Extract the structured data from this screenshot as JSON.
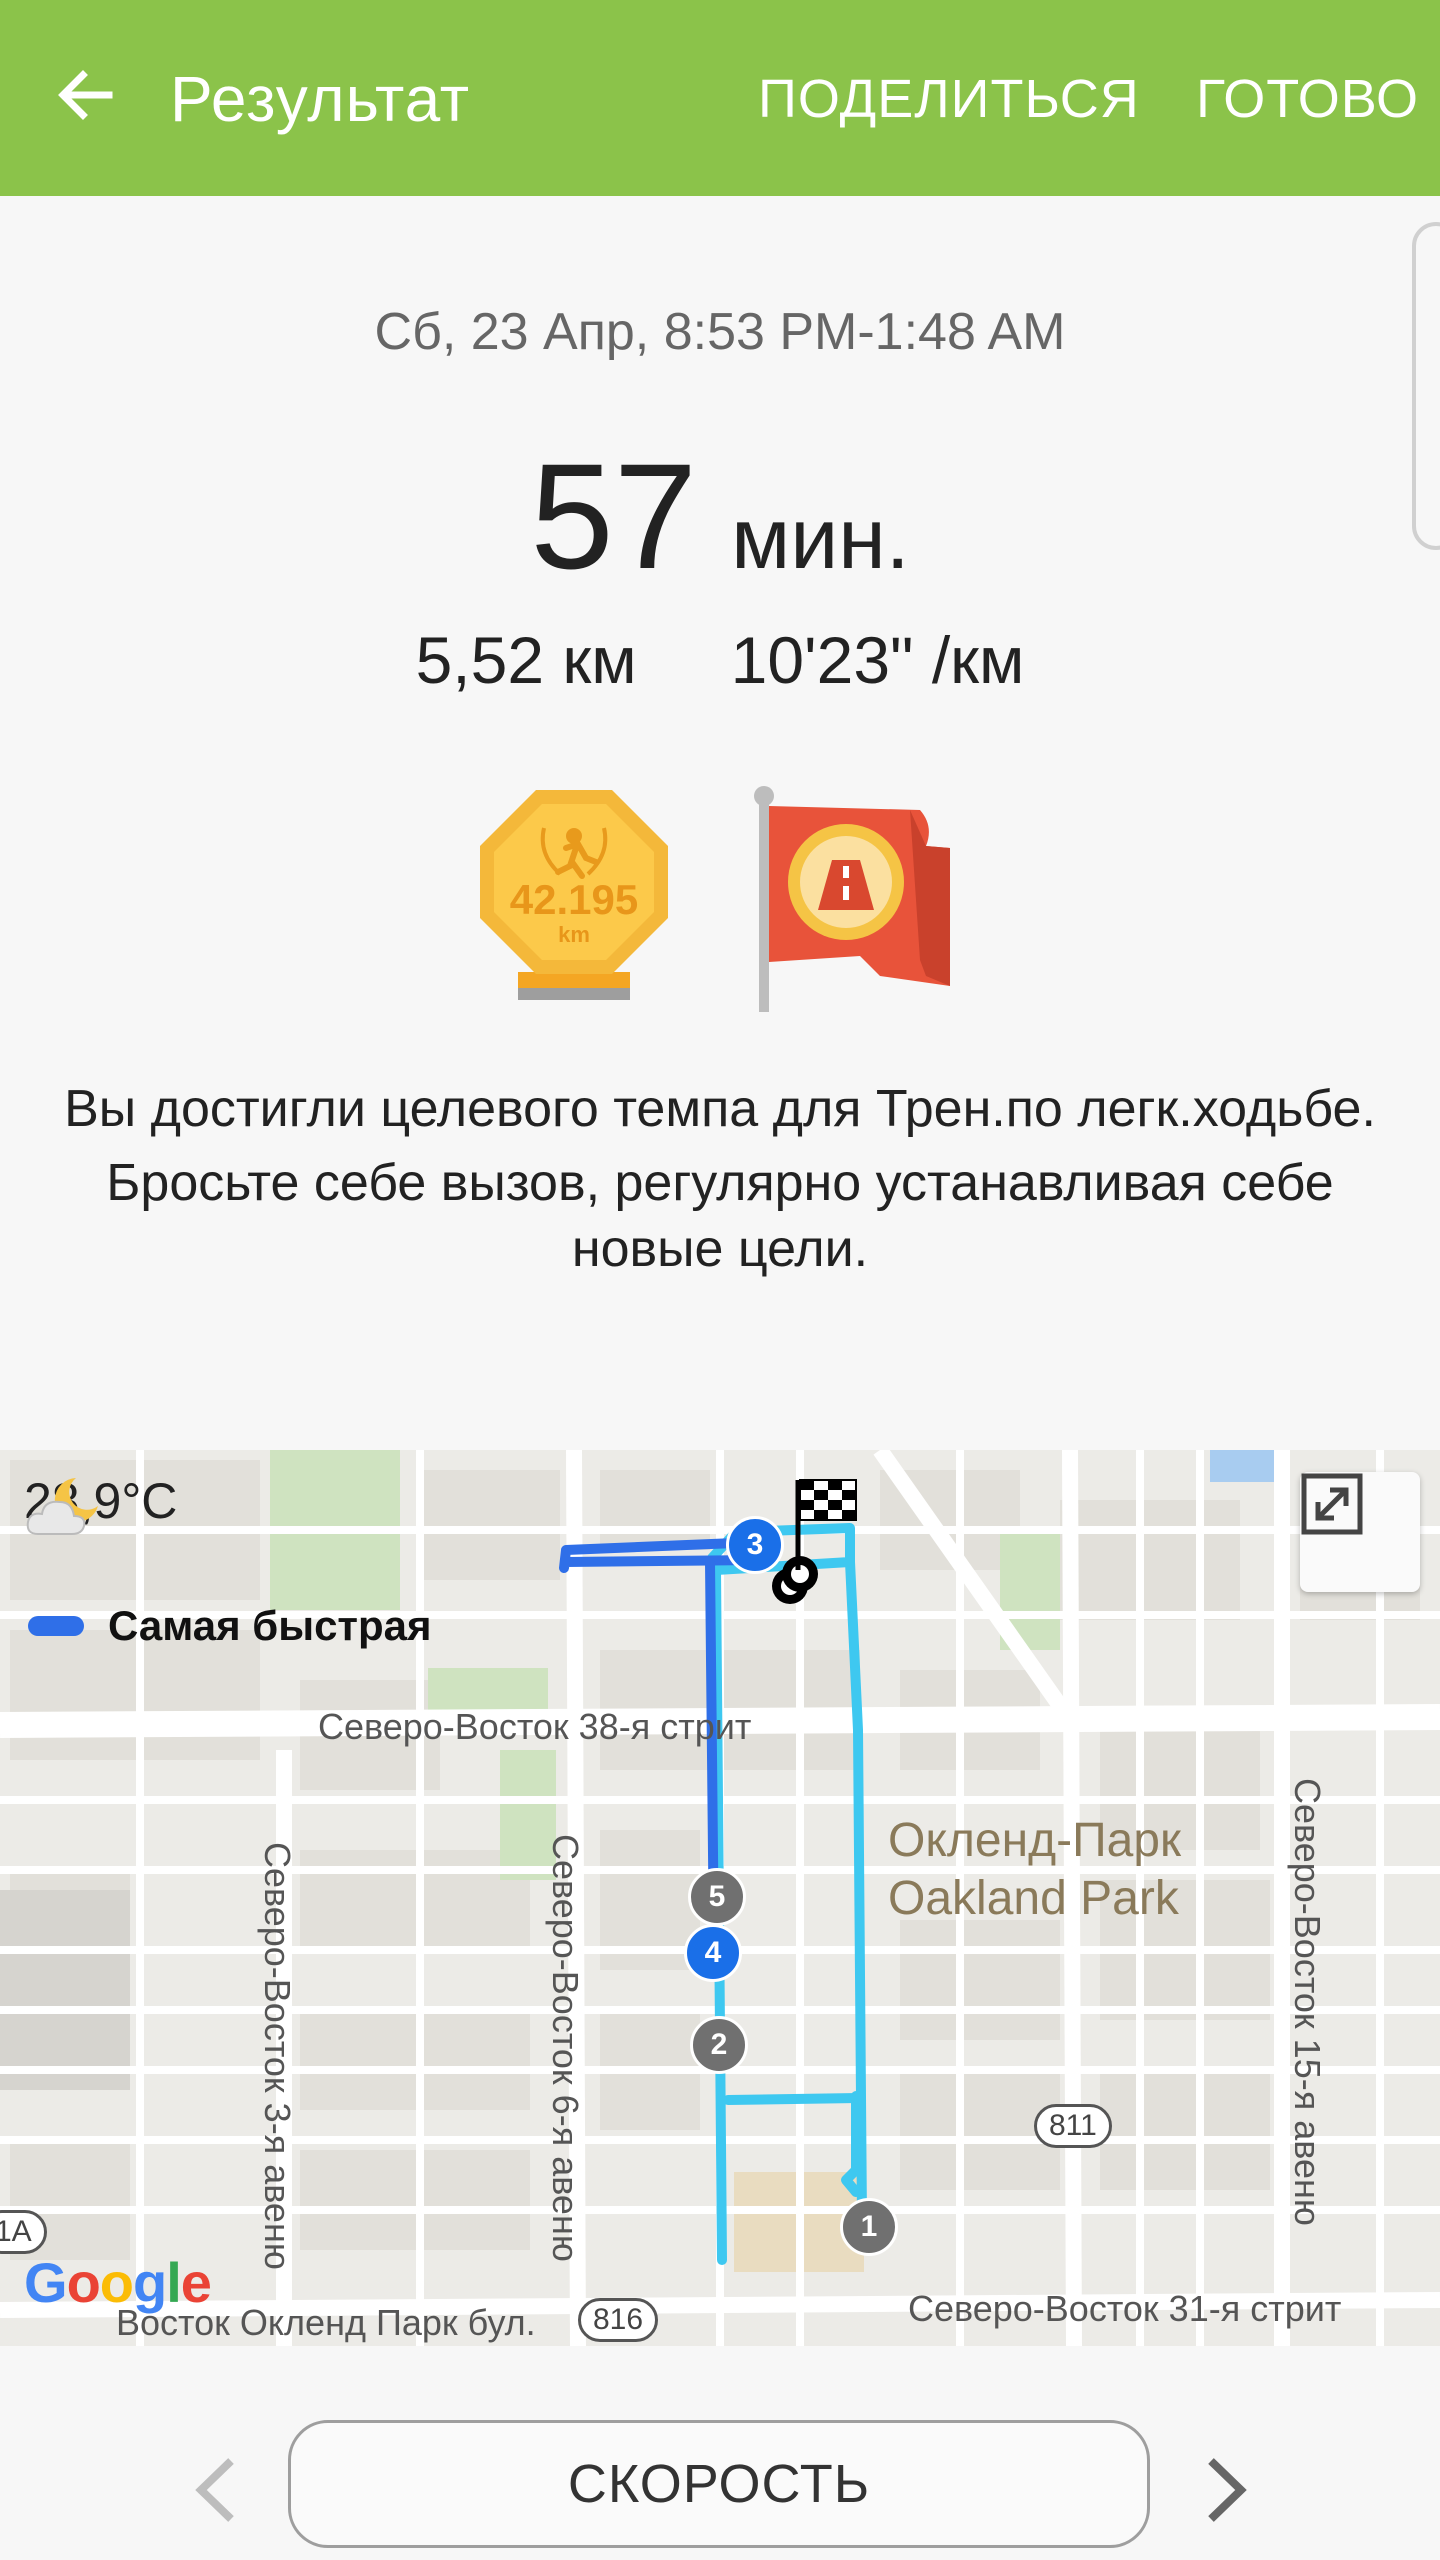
{
  "appbar": {
    "title": "Результат",
    "share_label": "ПОДЕЛИТЬСЯ",
    "done_label": "ГОТОВО",
    "color": "#8bc34a"
  },
  "workout": {
    "datetime": "Сб, 23 Апр, 8:53 PM-1:48 AM",
    "duration_value": "57",
    "duration_unit": "мин.",
    "distance": "5,52 км",
    "pace": "10'23\" /км"
  },
  "badges": {
    "marathon_value": "42.195",
    "marathon_unit": "km"
  },
  "message": {
    "line1": "Вы достигли целевого темпа для Трен.по легк.ходьбе.",
    "line2": "Бросьте себе вызов, регулярно устанавливая себе новые цели."
  },
  "map": {
    "temperature": "28,9°C",
    "legend_label": "Самая быстрая",
    "legend_color": "#2f6fe8",
    "route_color": "#3ec8f0",
    "fast_route_color": "#2f6fe8",
    "street_38": "Северо-Восток 38-я стрит",
    "street_31": "Северо-Восток 31-я стрит",
    "avenue_3": "Северо-Восток 3-я авеню",
    "avenue_6": "Северо-Восток 6-я авеню",
    "avenue_15": "Северо-Восток 15-я авеню",
    "boulevard": "Восток Окленд Парк бул.",
    "district_ru": "Окленд-Парк",
    "district_en": "Oakland Park",
    "shield_811": "811",
    "shield_816": "816",
    "exit_1a": "1A",
    "google_letters": [
      "G",
      "o",
      "o",
      "g",
      "l",
      "e"
    ],
    "markers": [
      "1",
      "2",
      "3",
      "4",
      "5"
    ]
  },
  "bottom": {
    "metric_label": "СКОРОСТЬ"
  }
}
